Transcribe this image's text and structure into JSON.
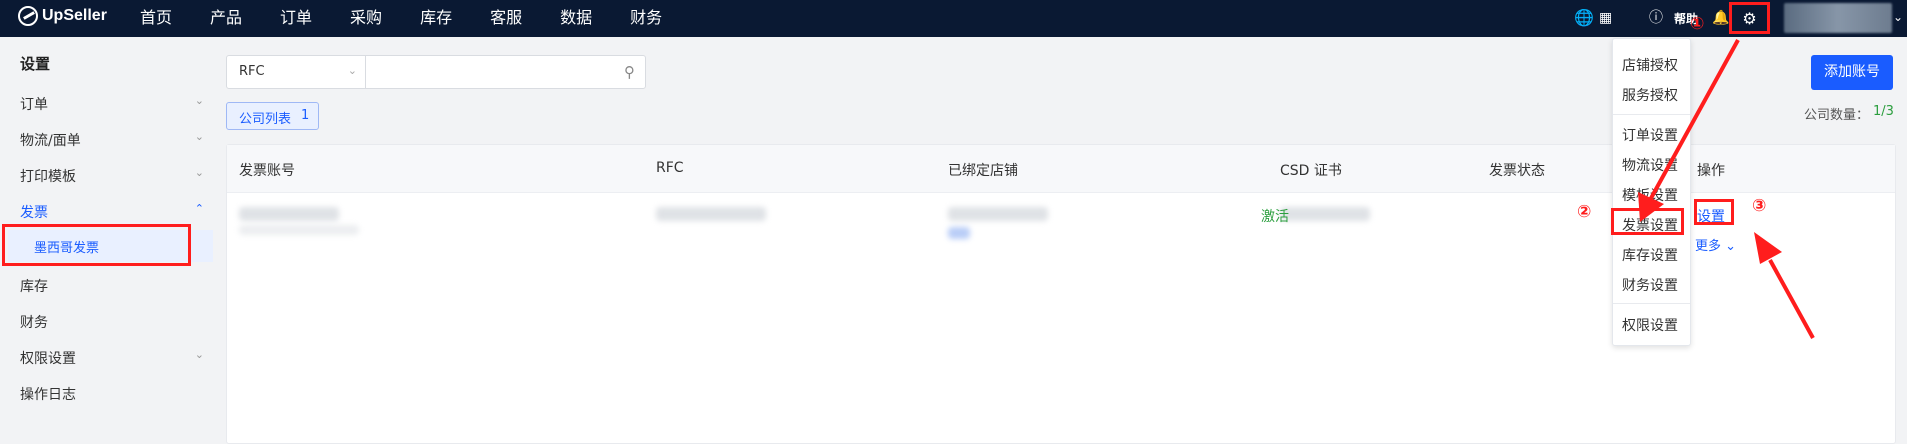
{
  "brand": {
    "name": "UpSeller"
  },
  "nav": [
    "首页",
    "产品",
    "订单",
    "采购",
    "库存",
    "客服",
    "数据",
    "财务"
  ],
  "topbar": {
    "help": "帮助",
    "icons": [
      "globe-icon",
      "apps-icon",
      "help-icon",
      "bell-icon",
      "gear-icon"
    ]
  },
  "sidebar": {
    "title": "设置",
    "items": [
      {
        "label": "订单",
        "chevron": "down"
      },
      {
        "label": "物流/面单",
        "chevron": "down"
      },
      {
        "label": "打印模板",
        "chevron": "down"
      },
      {
        "label": "发票",
        "chevron": "up",
        "active": true
      },
      {
        "label": "库存"
      },
      {
        "label": "财务"
      },
      {
        "label": "权限设置",
        "chevron": "down"
      },
      {
        "label": "操作日志"
      }
    ],
    "sub_item": "墨西哥发票"
  },
  "filter": {
    "select_value": "RFC",
    "search_placeholder": ""
  },
  "tab": {
    "label": "公司列表",
    "count": "1"
  },
  "actions": {
    "add_account": "添加账号",
    "company_count_label": "公司数量：",
    "company_count_value": "1/3"
  },
  "table": {
    "headers": [
      "发票账号",
      "RFC",
      "已绑定店铺",
      "CSD 证书",
      "发票状态",
      "操作"
    ],
    "row": {
      "status": "激活",
      "op_setting": "设置",
      "op_more": "更多"
    }
  },
  "dropdown": {
    "items": [
      "店铺授权",
      "服务授权",
      "订单设置",
      "物流设置",
      "模板设置",
      "发票设置",
      "库存设置",
      "财务设置",
      "权限设置"
    ]
  },
  "steps": [
    "①",
    "②",
    "③"
  ],
  "colors": {
    "topbar": "#0a1933",
    "accent": "#1a5cff",
    "highlight": "#ff1d1d",
    "success": "#2b9e3e"
  }
}
